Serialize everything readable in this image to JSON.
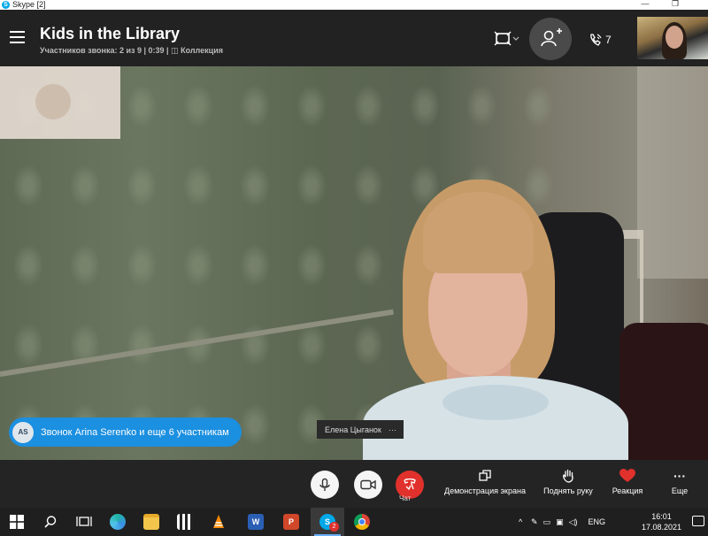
{
  "window": {
    "title": "Skype [2]",
    "minimize": "—",
    "maximize": "❐"
  },
  "call": {
    "title": "Kids in the Library",
    "participants_status": "Участников звонка: 2 из 9 | 0:39 |",
    "collection": "Коллекция",
    "participant_count": "7"
  },
  "caption": {
    "initials": "AS",
    "text": "Звонок Arina Serenko и еще 6 участникам"
  },
  "speaker": {
    "name": "Елена Цыганок",
    "more": "···"
  },
  "toolbar": {
    "chat": "Чат",
    "share_screen": "Демонстрация экрана",
    "raise_hand": "Поднять руку",
    "reaction": "Реакция",
    "more": "Еще",
    "more_glyph": "···"
  },
  "taskbar": {
    "language": "ENG",
    "time": "16:01",
    "date": "17.08.2021",
    "skype_badge": "2",
    "word_label": "W",
    "ppt_label": "P",
    "tray_arrow": "^"
  },
  "colors": {
    "accent": "#1b8fe0",
    "hangup": "#e0312c",
    "reaction": "#e0312c",
    "header_bg": "#222222"
  }
}
